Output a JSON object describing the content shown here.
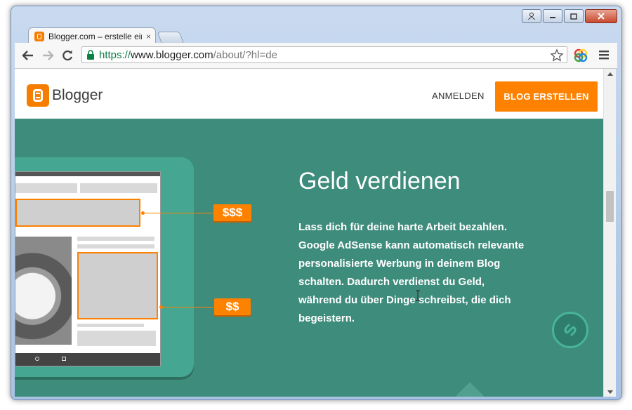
{
  "browser": {
    "tab": {
      "title": "Blogger.com – erstelle ein",
      "close": "×"
    },
    "address": {
      "scheme": "https://",
      "host": "www.blogger.com",
      "path": "/about/?hl=de"
    }
  },
  "site": {
    "logo_text": "Blogger",
    "signin_label": "ANMELDEN",
    "create_label": "BLOG ERSTELLEN",
    "accent": "#ff8100",
    "hero_bg": "#3e8c7c"
  },
  "hero": {
    "title": "Geld verdienen",
    "text": "Lass dich für deine harte Arbeit bezahlen. Google AdSense kann automatisch relevante personalisierte Werbung in deinem Blog schalten. Dadurch verdienst du Geld, während du über Dinge schreibst, die dich begeistern.",
    "price_big": "$$$",
    "price_small": "$$",
    "icons": [
      "tablet-illustration",
      "adsense-circle-icon"
    ]
  }
}
